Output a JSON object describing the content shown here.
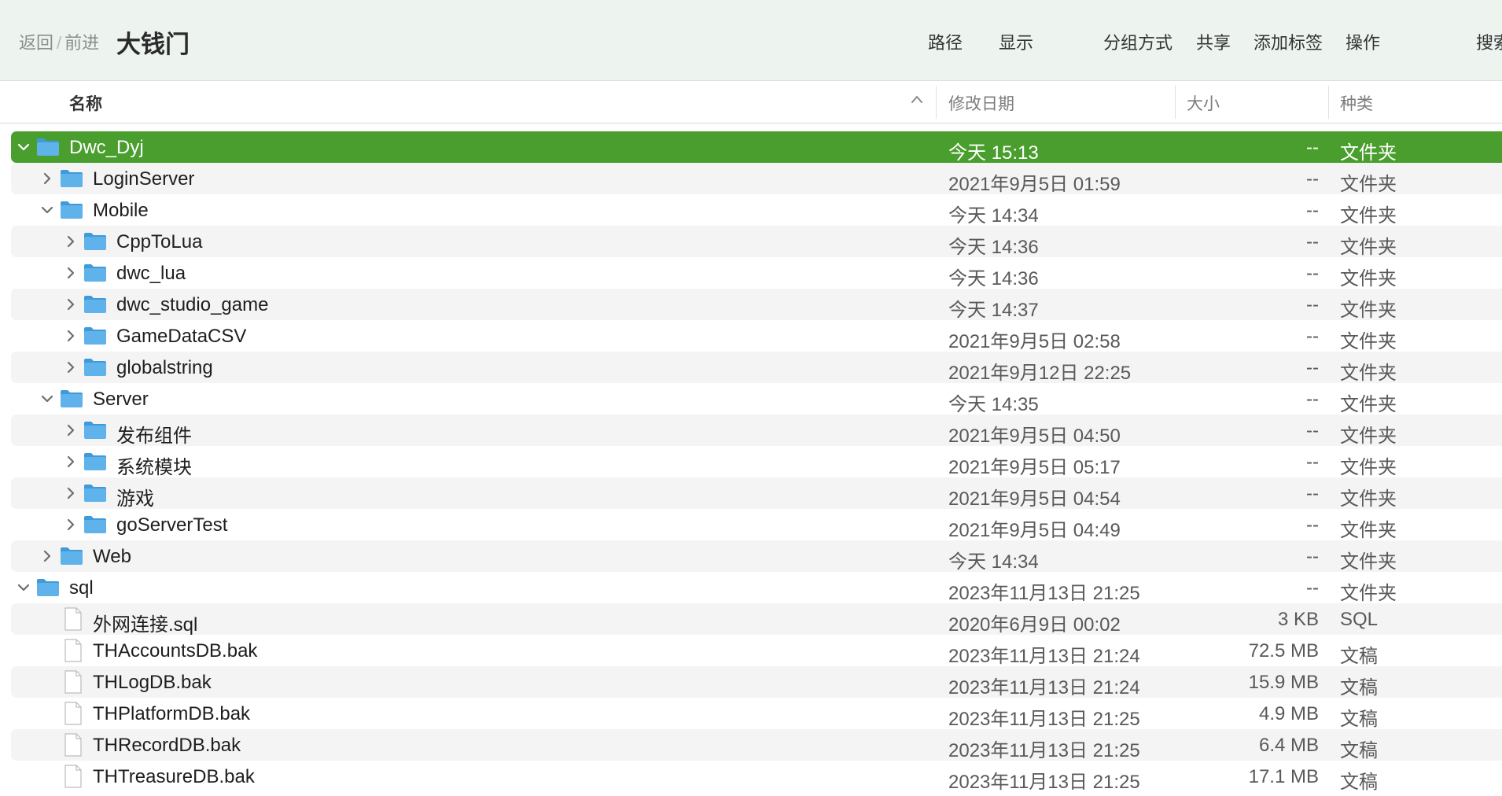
{
  "toolbar": {
    "back_label": "返回",
    "separator": "/",
    "forward_label": "前进",
    "title": "大钱门",
    "path_label": "路径",
    "view_label": "显示",
    "group_label": "分组方式",
    "share_label": "共享",
    "tags_label": "添加标签",
    "action_label": "操作",
    "search_label": "搜索"
  },
  "columns": {
    "name": "名称",
    "date": "修改日期",
    "size": "大小",
    "kind": "种类"
  },
  "colors": {
    "selection": "#4a9e2e",
    "folder": "#5fb2ea",
    "toolbar_bg": "#edf4ef"
  },
  "rows": [
    {
      "name": "Dwc_Dyj",
      "date": "今天 15:13",
      "size": "--",
      "kind": "文件夹",
      "type": "folder",
      "level": 0,
      "expanded": true,
      "selected": true
    },
    {
      "name": "LoginServer",
      "date": "2021年9月5日 01:59",
      "size": "--",
      "kind": "文件夹",
      "type": "folder",
      "level": 1,
      "expanded": false
    },
    {
      "name": "Mobile",
      "date": "今天 14:34",
      "size": "--",
      "kind": "文件夹",
      "type": "folder",
      "level": 1,
      "expanded": true
    },
    {
      "name": "CppToLua",
      "date": "今天 14:36",
      "size": "--",
      "kind": "文件夹",
      "type": "folder",
      "level": 2,
      "expanded": false
    },
    {
      "name": "dwc_lua",
      "date": "今天 14:36",
      "size": "--",
      "kind": "文件夹",
      "type": "folder",
      "level": 2,
      "expanded": false
    },
    {
      "name": "dwc_studio_game",
      "date": "今天 14:37",
      "size": "--",
      "kind": "文件夹",
      "type": "folder",
      "level": 2,
      "expanded": false
    },
    {
      "name": "GameDataCSV",
      "date": "2021年9月5日 02:58",
      "size": "--",
      "kind": "文件夹",
      "type": "folder",
      "level": 2,
      "expanded": false
    },
    {
      "name": "globalstring",
      "date": "2021年9月12日 22:25",
      "size": "--",
      "kind": "文件夹",
      "type": "folder",
      "level": 2,
      "expanded": false
    },
    {
      "name": "Server",
      "date": "今天 14:35",
      "size": "--",
      "kind": "文件夹",
      "type": "folder",
      "level": 1,
      "expanded": true
    },
    {
      "name": "发布组件",
      "date": "2021年9月5日 04:50",
      "size": "--",
      "kind": "文件夹",
      "type": "folder",
      "level": 2,
      "expanded": false
    },
    {
      "name": "系统模块",
      "date": "2021年9月5日 05:17",
      "size": "--",
      "kind": "文件夹",
      "type": "folder",
      "level": 2,
      "expanded": false
    },
    {
      "name": "游戏",
      "date": "2021年9月5日 04:54",
      "size": "--",
      "kind": "文件夹",
      "type": "folder",
      "level": 2,
      "expanded": false
    },
    {
      "name": "goServerTest",
      "date": "2021年9月5日 04:49",
      "size": "--",
      "kind": "文件夹",
      "type": "folder",
      "level": 2,
      "expanded": false
    },
    {
      "name": "Web",
      "date": "今天 14:34",
      "size": "--",
      "kind": "文件夹",
      "type": "folder",
      "level": 1,
      "expanded": false
    },
    {
      "name": "sql",
      "date": "2023年11月13日 21:25",
      "size": "--",
      "kind": "文件夹",
      "type": "folder",
      "level": 0,
      "expanded": true
    },
    {
      "name": "外网连接.sql",
      "date": "2020年6月9日 00:02",
      "size": "3 KB",
      "kind": "SQL",
      "type": "file",
      "level": 1
    },
    {
      "name": "THAccountsDB.bak",
      "date": "2023年11月13日 21:24",
      "size": "72.5 MB",
      "kind": "文稿",
      "type": "file",
      "level": 1
    },
    {
      "name": "THLogDB.bak",
      "date": "2023年11月13日 21:24",
      "size": "15.9 MB",
      "kind": "文稿",
      "type": "file",
      "level": 1
    },
    {
      "name": "THPlatformDB.bak",
      "date": "2023年11月13日 21:25",
      "size": "4.9 MB",
      "kind": "文稿",
      "type": "file",
      "level": 1
    },
    {
      "name": "THRecordDB.bak",
      "date": "2023年11月13日 21:25",
      "size": "6.4 MB",
      "kind": "文稿",
      "type": "file",
      "level": 1
    },
    {
      "name": "THTreasureDB.bak",
      "date": "2023年11月13日 21:25",
      "size": "17.1 MB",
      "kind": "文稿",
      "type": "file",
      "level": 1
    }
  ]
}
